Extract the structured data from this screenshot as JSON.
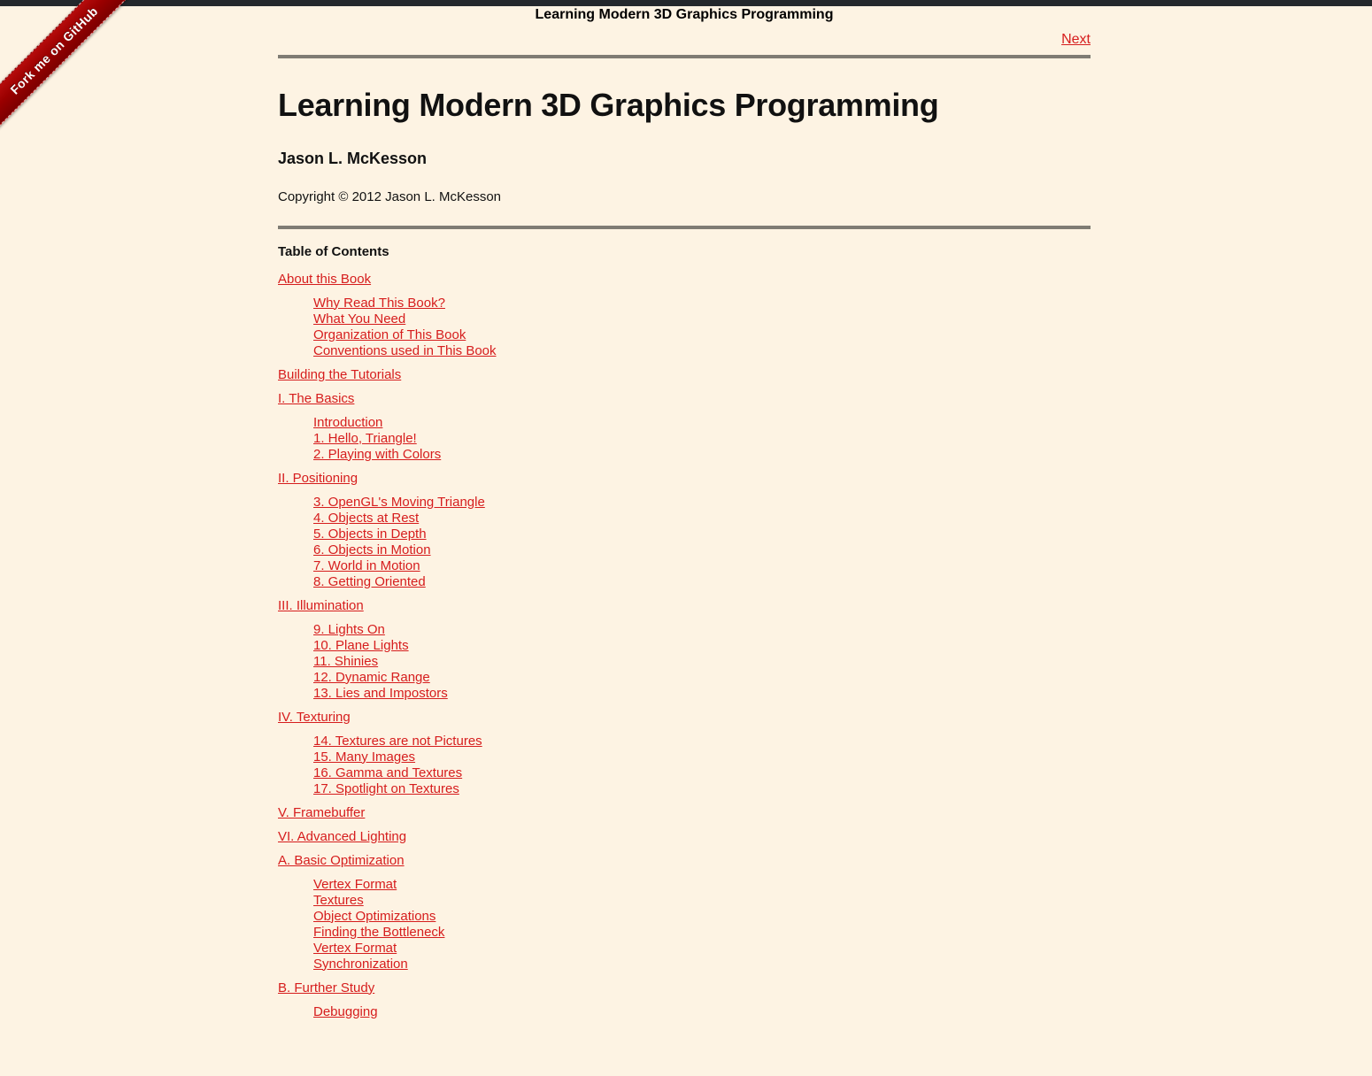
{
  "topbar": {
    "color": "#24282c"
  },
  "ribbon": {
    "label": "Fork me on GitHub",
    "background": "#9e0000",
    "text_color": "#ffffff"
  },
  "navheader": {
    "title": "Learning Modern 3D Graphics Programming",
    "prev_label": "",
    "next_label": "Next"
  },
  "book": {
    "title": "Learning Modern 3D Graphics Programming",
    "author": "Jason L. McKesson",
    "copyright": "Copyright © 2012 Jason L. McKesson"
  },
  "colors": {
    "background": "#fdf3e3",
    "link": "#d61d1d",
    "rule": "#7f7c74",
    "text": "#111111"
  },
  "toc": {
    "title": "Table of Contents",
    "entries": [
      {
        "label": "About this Book",
        "children": [
          "Why Read This Book?",
          "What You Need",
          "Organization of This Book",
          "Conventions used in This Book"
        ]
      },
      {
        "label": "Building the Tutorials",
        "children": []
      },
      {
        "label": "I. The Basics",
        "children": [
          "Introduction",
          "1. Hello, Triangle!",
          "2. Playing with Colors"
        ]
      },
      {
        "label": "II. Positioning",
        "children": [
          "3. OpenGL's Moving Triangle",
          "4. Objects at Rest",
          "5. Objects in Depth",
          "6. Objects in Motion",
          "7. World in Motion",
          "8. Getting Oriented"
        ]
      },
      {
        "label": "III. Illumination",
        "children": [
          "9. Lights On",
          "10. Plane Lights",
          "11. Shinies",
          "12. Dynamic Range",
          "13. Lies and Impostors"
        ]
      },
      {
        "label": "IV. Texturing",
        "children": [
          "14. Textures are not Pictures",
          "15. Many Images",
          "16. Gamma and Textures",
          "17. Spotlight on Textures"
        ]
      },
      {
        "label": "V. Framebuffer",
        "children": []
      },
      {
        "label": "VI. Advanced Lighting",
        "children": []
      },
      {
        "label": "A. Basic Optimization",
        "children": [
          "Vertex Format",
          "Textures",
          "Object Optimizations",
          "Finding the Bottleneck",
          "Vertex Format",
          "Synchronization"
        ]
      },
      {
        "label": "B. Further Study",
        "children": [
          "Debugging"
        ]
      }
    ]
  }
}
